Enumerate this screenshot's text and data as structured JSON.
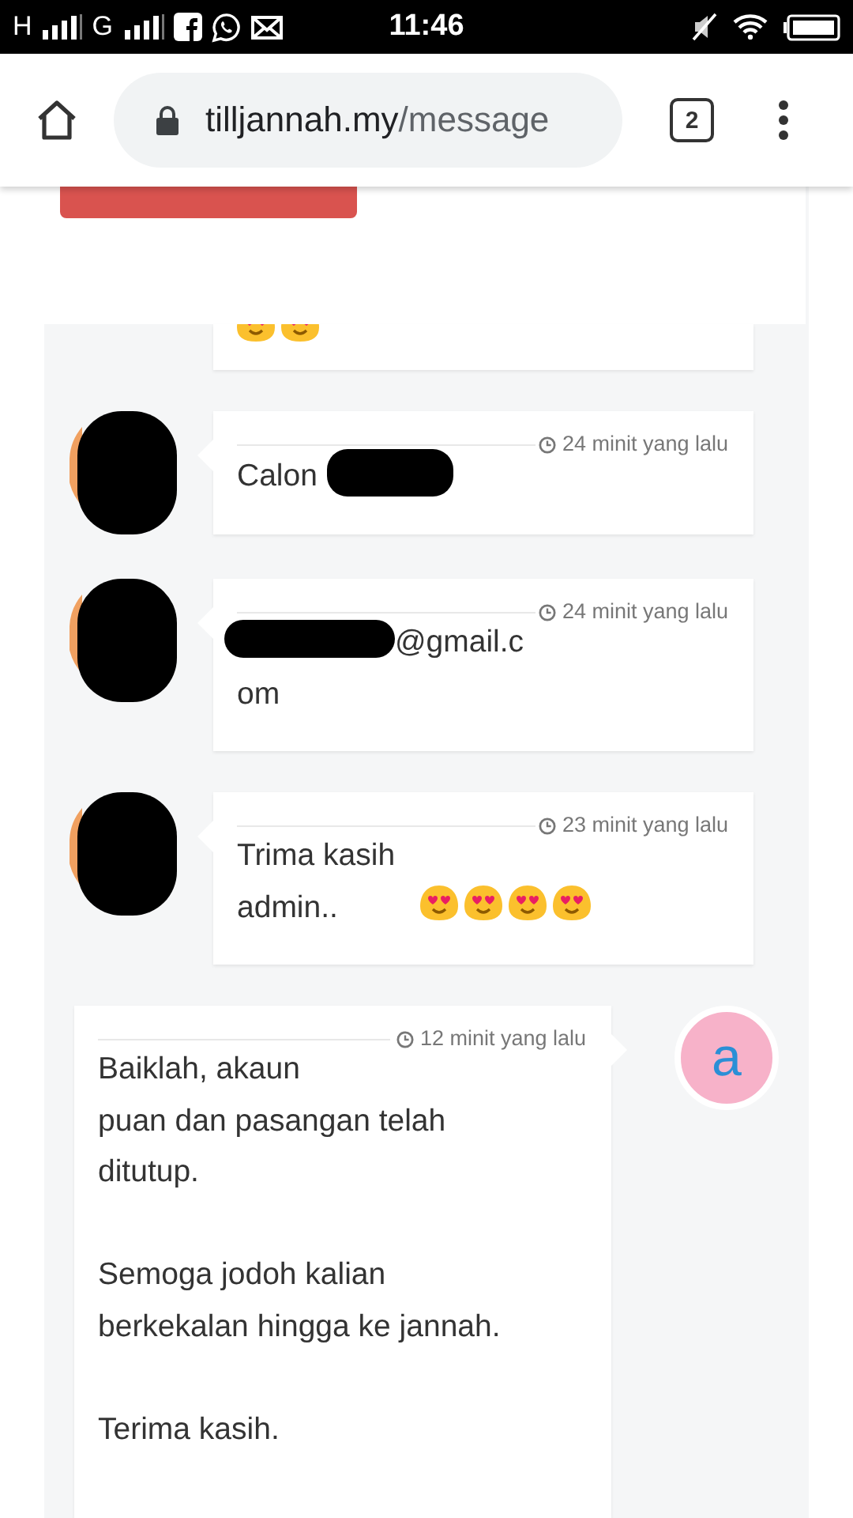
{
  "status_bar": {
    "network_1": "H",
    "network_2": "G",
    "time": "11:46"
  },
  "browser": {
    "url_host": "tilljannah.my",
    "url_path": "/message",
    "tab_count": "2"
  },
  "messages": [
    {
      "kind": "partial",
      "emojis": [
        {
          "kind": "heart_eyes"
        },
        {
          "kind": "heart_eyes"
        }
      ]
    },
    {
      "outgoing": false,
      "kind": "redacted_after",
      "time": "24 minit yang lalu",
      "text": "Calon"
    },
    {
      "outgoing": false,
      "kind": "redacted_before",
      "time": "24 minit yang lalu",
      "text_lines": [
        "@gmail.c",
        "om"
      ]
    },
    {
      "outgoing": false,
      "kind": "plain",
      "time": "23 minit yang lalu",
      "text": "Trima kasih admin..",
      "emojis": [
        {
          "kind": "heart_eyes"
        },
        {
          "kind": "heart_eyes"
        },
        {
          "kind": "heart_eyes"
        },
        {
          "kind": "heart_eyes"
        }
      ]
    },
    {
      "outgoing": true,
      "kind": "plain",
      "avatar_letter": "a",
      "time": "12 minit yang lalu",
      "text": "Baiklah, akaun\npuan dan pasangan telah\nditutup.\n\nSemoga jodoh kalian\nberkekalan hingga ke jannah.\n\nTerima kasih."
    }
  ]
}
